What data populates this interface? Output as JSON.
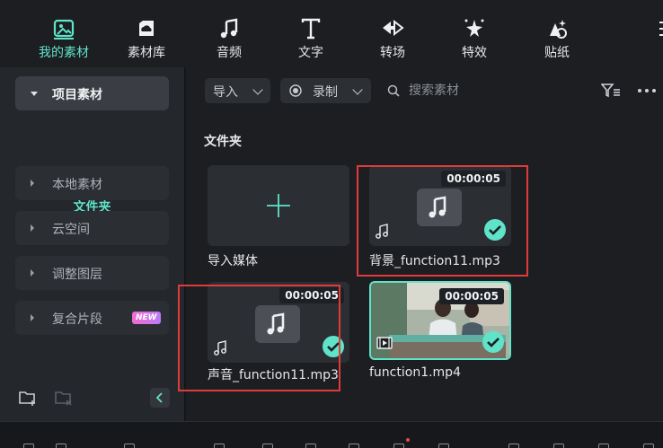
{
  "toolbar": {
    "items": [
      {
        "label": "我的素材",
        "icon": "media-icon",
        "active": true
      },
      {
        "label": "素材库",
        "icon": "cloud-library-icon",
        "active": false
      },
      {
        "label": "音频",
        "icon": "music-note-icon",
        "active": false
      },
      {
        "label": "文字",
        "icon": "text-icon",
        "active": false
      },
      {
        "label": "转场",
        "icon": "transition-icon",
        "active": false
      },
      {
        "label": "特效",
        "icon": "effects-icon",
        "active": false
      },
      {
        "label": "贴纸",
        "icon": "sticker-icon",
        "active": false
      }
    ]
  },
  "sidebar": {
    "project_media": "项目素材",
    "folder": "文件夹",
    "items": [
      {
        "label": "本地素材"
      },
      {
        "label": "云空间"
      },
      {
        "label": "调整图层"
      },
      {
        "label": "复合片段",
        "badge": "NEW"
      }
    ],
    "icons": [
      "new-folder-icon",
      "delete-folder-icon",
      "collapse-left-icon"
    ]
  },
  "filter": {
    "import_label": "导入",
    "record_label": "录制",
    "search_placeholder": "搜索素材"
  },
  "main": {
    "section_title": "文件夹",
    "cards": [
      {
        "kind": "import",
        "label": "导入媒体"
      },
      {
        "kind": "audio",
        "label": "背景_function11.mp3",
        "duration": "00:00:05",
        "checked": true
      },
      {
        "kind": "audio",
        "label": "声音_function11.mp3",
        "duration": "00:00:05",
        "checked": true
      },
      {
        "kind": "video",
        "label": "function1.mp4",
        "duration": "00:00:05",
        "checked": true,
        "selected": true
      }
    ]
  },
  "colors": {
    "accent": "#5fe3c9",
    "highlight_box": "#e03a3a",
    "panel_bg": "#24272c",
    "main_bg": "#1c1e22"
  }
}
